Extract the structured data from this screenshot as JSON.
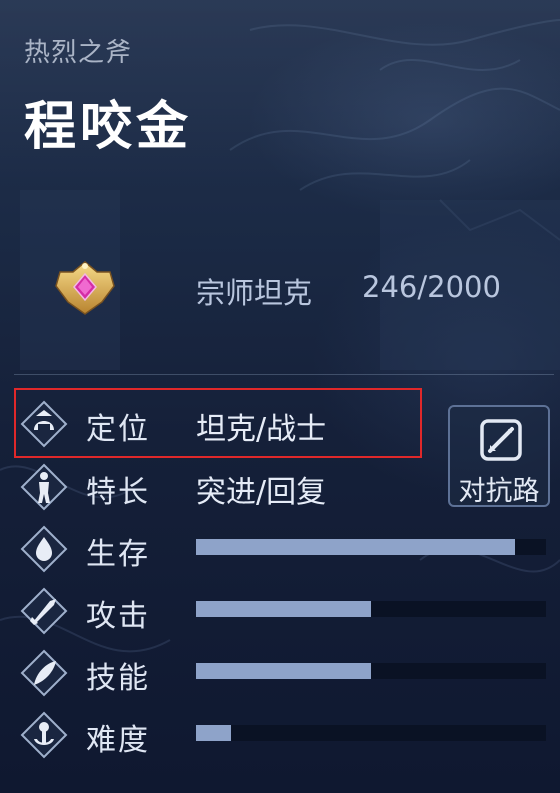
{
  "hero": {
    "subtitle": "热烈之斧",
    "name": "程咬金"
  },
  "rank": {
    "icon": "rank-emblem-icon",
    "title": "宗师坦克",
    "points": "246/2000"
  },
  "profile": {
    "role_label": "定位",
    "role_value": "坦克/战士",
    "specialty_label": "特长",
    "specialty_value": "突进/回复"
  },
  "stats": [
    {
      "label": "生存",
      "icon": "survival-drop-icon",
      "fill": 0.91
    },
    {
      "label": "攻击",
      "icon": "attack-sword-icon",
      "fill": 0.5
    },
    {
      "label": "技能",
      "icon": "skill-feather-icon",
      "fill": 0.5
    },
    {
      "label": "难度",
      "icon": "difficulty-anchor-icon",
      "fill": 0.1
    }
  ],
  "matchup_button": {
    "label": "对抗路",
    "icon": "matchup-lane-icon"
  },
  "colors": {
    "highlight": "#e0282a",
    "bar_fill": "#8ea3c9",
    "bar_track": "#0a1224"
  }
}
